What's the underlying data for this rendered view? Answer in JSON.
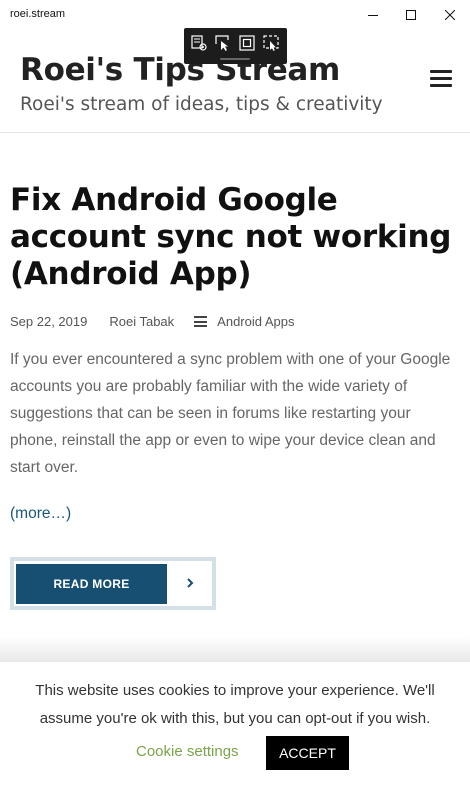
{
  "window": {
    "title": "roei.stream"
  },
  "site": {
    "title": "Roei's Tips Stream",
    "tagline": "Roei's stream of ideas, tips & creativity"
  },
  "post": {
    "title": "Fix Android Google account sync not working (Android App)",
    "date": "Sep 22, 2019",
    "author": "Roei Tabak",
    "category": "Android Apps",
    "excerpt": "If you ever encountered a sync problem with one of your Google accounts you are probably familiar with the wide variety of suggestions that can be seen in forums like restarting your phone, reinstall the app or even to wipe your device clean and start over.",
    "more_link": "(more…)",
    "read_more_label": "READ MORE"
  },
  "cookie": {
    "message": "This website uses cookies to improve your experience. We'll assume you're ok with this, but you can opt-out if you wish.",
    "settings_label": "Cookie settings",
    "accept_label": "ACCEPT"
  },
  "icons": {
    "minimize": "minimize-icon",
    "maximize": "maximize-icon",
    "close": "close-icon",
    "menu": "hamburger-icon",
    "category": "list-icon",
    "read_more_arrow": "chevron-right-icon",
    "devtools": [
      "select-element-icon",
      "inspect-cursor-icon",
      "frame-icon",
      "layout-adorner-icon"
    ]
  },
  "colors": {
    "accent": "#174f72",
    "link": "#19587a",
    "cookie_settings": "#7aa44a"
  }
}
